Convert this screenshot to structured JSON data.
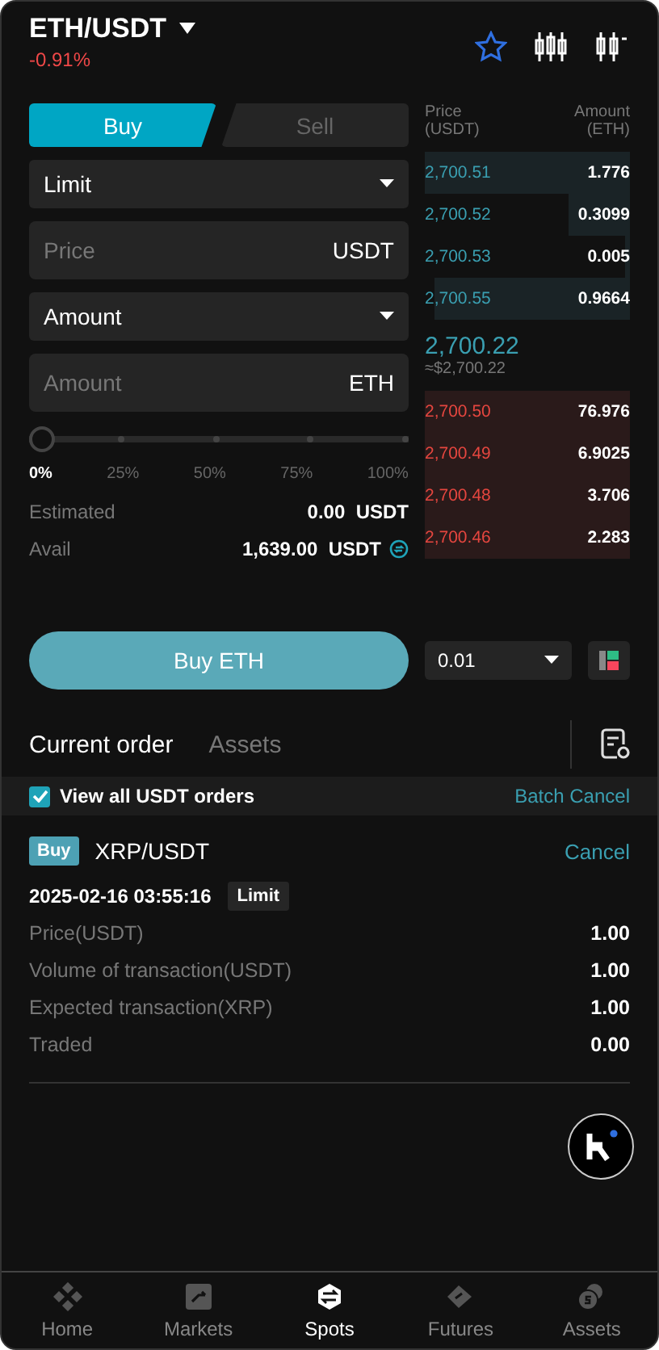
{
  "header": {
    "pair": "ETH/USDT",
    "change": "-0.91%",
    "favorite": true
  },
  "side_tabs": [
    {
      "label": "Buy",
      "selected": true
    },
    {
      "label": "Sell",
      "selected": false
    }
  ],
  "order_type": {
    "value": "Limit"
  },
  "price_field": {
    "placeholder": "Price",
    "unit": "USDT"
  },
  "amount_type": {
    "value": "Amount"
  },
  "amount_field": {
    "placeholder": "Amount",
    "unit": "ETH"
  },
  "slider": {
    "level": 0,
    "marks": [
      {
        "label": "0%",
        "selected": true
      },
      {
        "label": "25%",
        "selected": false
      },
      {
        "label": "50%",
        "selected": false
      },
      {
        "label": "75%",
        "selected": false
      },
      {
        "label": "100%",
        "selected": false
      }
    ]
  },
  "estimated": {
    "label": "Estimated",
    "value": "0.00",
    "unit": "USDT"
  },
  "avail": {
    "label": "Avail",
    "value": "1,639.00",
    "unit": "USDT"
  },
  "submit": "Buy ETH",
  "order_book": {
    "price_header": [
      "Price",
      "(USDT)"
    ],
    "amount_header": [
      "Amount",
      "(ETH)"
    ],
    "top": [
      {
        "price": "2,700.51",
        "amount": "1.776",
        "level": 1
      },
      {
        "price": "2,700.52",
        "amount": "0.3099",
        "level": 0.3
      },
      {
        "price": "2,700.53",
        "amount": "0.005",
        "level": 0.02
      },
      {
        "price": "2,700.55",
        "amount": "0.9664",
        "level": 0.95
      }
    ],
    "last_price": "2,700.22",
    "last_price_usd": "≈$2,700.22",
    "bottom": [
      {
        "price": "2,700.50",
        "amount": "76.976",
        "level": 1
      },
      {
        "price": "2,700.49",
        "amount": "6.9025",
        "level": 1
      },
      {
        "price": "2,700.48",
        "amount": "3.706",
        "level": 1
      },
      {
        "price": "2,700.46",
        "amount": "2.283",
        "level": 1
      }
    ],
    "precision": "0.01"
  },
  "order_tabs": [
    {
      "label": "Current order",
      "selected": true
    },
    {
      "label": "Assets",
      "selected": false
    }
  ],
  "view_all": {
    "label": "View all USDT orders",
    "checked": true
  },
  "batch_cancel": "Batch Cancel",
  "orders": [
    {
      "side": "Buy",
      "pair": "XRP/USDT",
      "cancel": "Cancel",
      "time": "2025-02-16 03:55:16",
      "type": "Limit",
      "fields": [
        {
          "label": "Price(USDT)",
          "value": "1.00"
        },
        {
          "label": "Volume of transaction(USDT)",
          "value": "1.00"
        },
        {
          "label": "Expected transaction(XRP)",
          "value": "1.00"
        },
        {
          "label": "Traded",
          "value": "0.00"
        }
      ]
    }
  ],
  "nav": [
    {
      "label": "Home",
      "kind": "home",
      "selected": false
    },
    {
      "label": "Markets",
      "kind": "markets",
      "selected": false
    },
    {
      "label": "Spots",
      "kind": "spots",
      "selected": true
    },
    {
      "label": "Futures",
      "kind": "futures",
      "selected": false
    },
    {
      "label": "Assets",
      "kind": "assets",
      "selected": false
    }
  ]
}
